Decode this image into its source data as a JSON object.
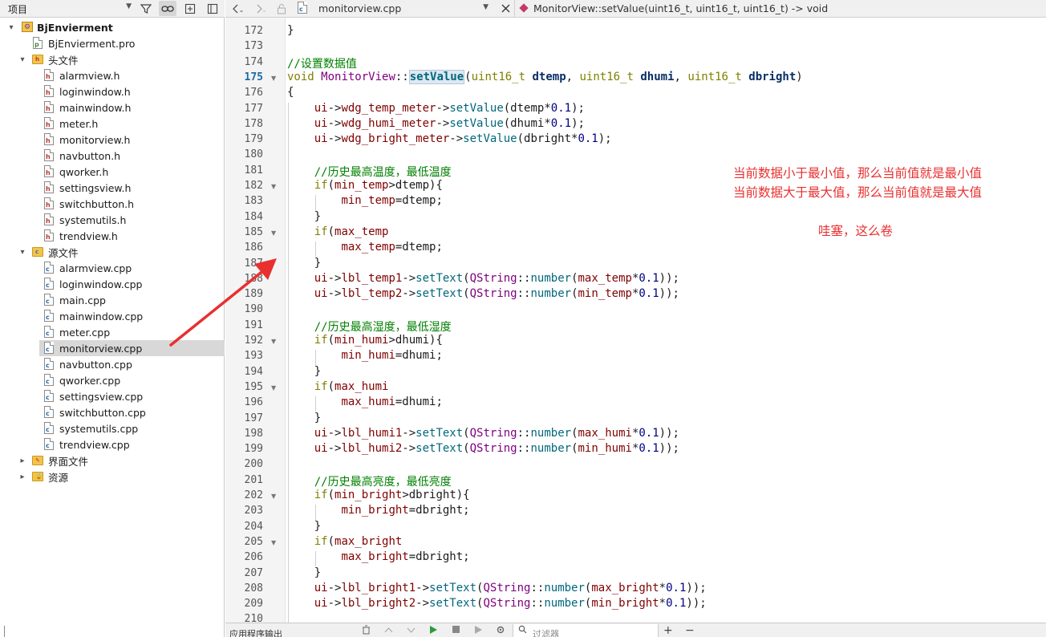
{
  "left_toolbar": {
    "project_selector": "项目",
    "icons": [
      "filter-icon",
      "link-icon",
      "add-split-icon",
      "sidebar-toggle-icon"
    ]
  },
  "project_tree": {
    "root": "BjEnvierment",
    "pro_file": "BjEnvierment.pro",
    "headers_folder": "头文件",
    "headers": [
      "alarmview.h",
      "loginwindow.h",
      "mainwindow.h",
      "meter.h",
      "monitorview.h",
      "navbutton.h",
      "qworker.h",
      "settingsview.h",
      "switchbutton.h",
      "systemutils.h",
      "trendview.h"
    ],
    "sources_folder": "源文件",
    "sources": [
      "alarmview.cpp",
      "loginwindow.cpp",
      "main.cpp",
      "mainwindow.cpp",
      "meter.cpp",
      "monitorview.cpp",
      "navbutton.cpp",
      "qworker.cpp",
      "settingsview.cpp",
      "switchbutton.cpp",
      "systemutils.cpp",
      "trendview.cpp"
    ],
    "selected": "monitorview.cpp",
    "forms_folder": "界面文件",
    "resources_folder": "资源"
  },
  "editor_toolbar": {
    "file": "monitorview.cpp",
    "function": "MonitorView::setValue(uint16_t, uint16_t, uint16_t) -> void"
  },
  "editor": {
    "current_line": 175,
    "line_numbers": [
      "172",
      "173",
      "174",
      "175",
      "176",
      "177",
      "178",
      "179",
      "180",
      "181",
      "182",
      "183",
      "184",
      "185",
      "186",
      "187",
      "188",
      "189",
      "190",
      "191",
      "192",
      "193",
      "194",
      "195",
      "196",
      "197",
      "198",
      "199",
      "200",
      "201",
      "202",
      "203",
      "204",
      "205",
      "206",
      "207",
      "208",
      "209",
      "210"
    ],
    "folded_lines": [
      "175",
      "182",
      "185",
      "192",
      "195",
      "202",
      "205"
    ]
  },
  "annotations": {
    "line1": "当前数据小于最小值，那么当前值就是最小值",
    "line2": "当前数据大于最大值，那么当前值就是最大值",
    "line3": "哇塞，这么卷"
  },
  "bottom_bar": {
    "title": "应用程序输出",
    "filter_placeholder": "过滤器",
    "plus": "+",
    "minus": "−"
  },
  "colors": {
    "annotation": "#e8302f",
    "keyword": "#808000",
    "comment": "#008000",
    "function": "#00677c",
    "member": "#800000",
    "number": "#000080"
  }
}
